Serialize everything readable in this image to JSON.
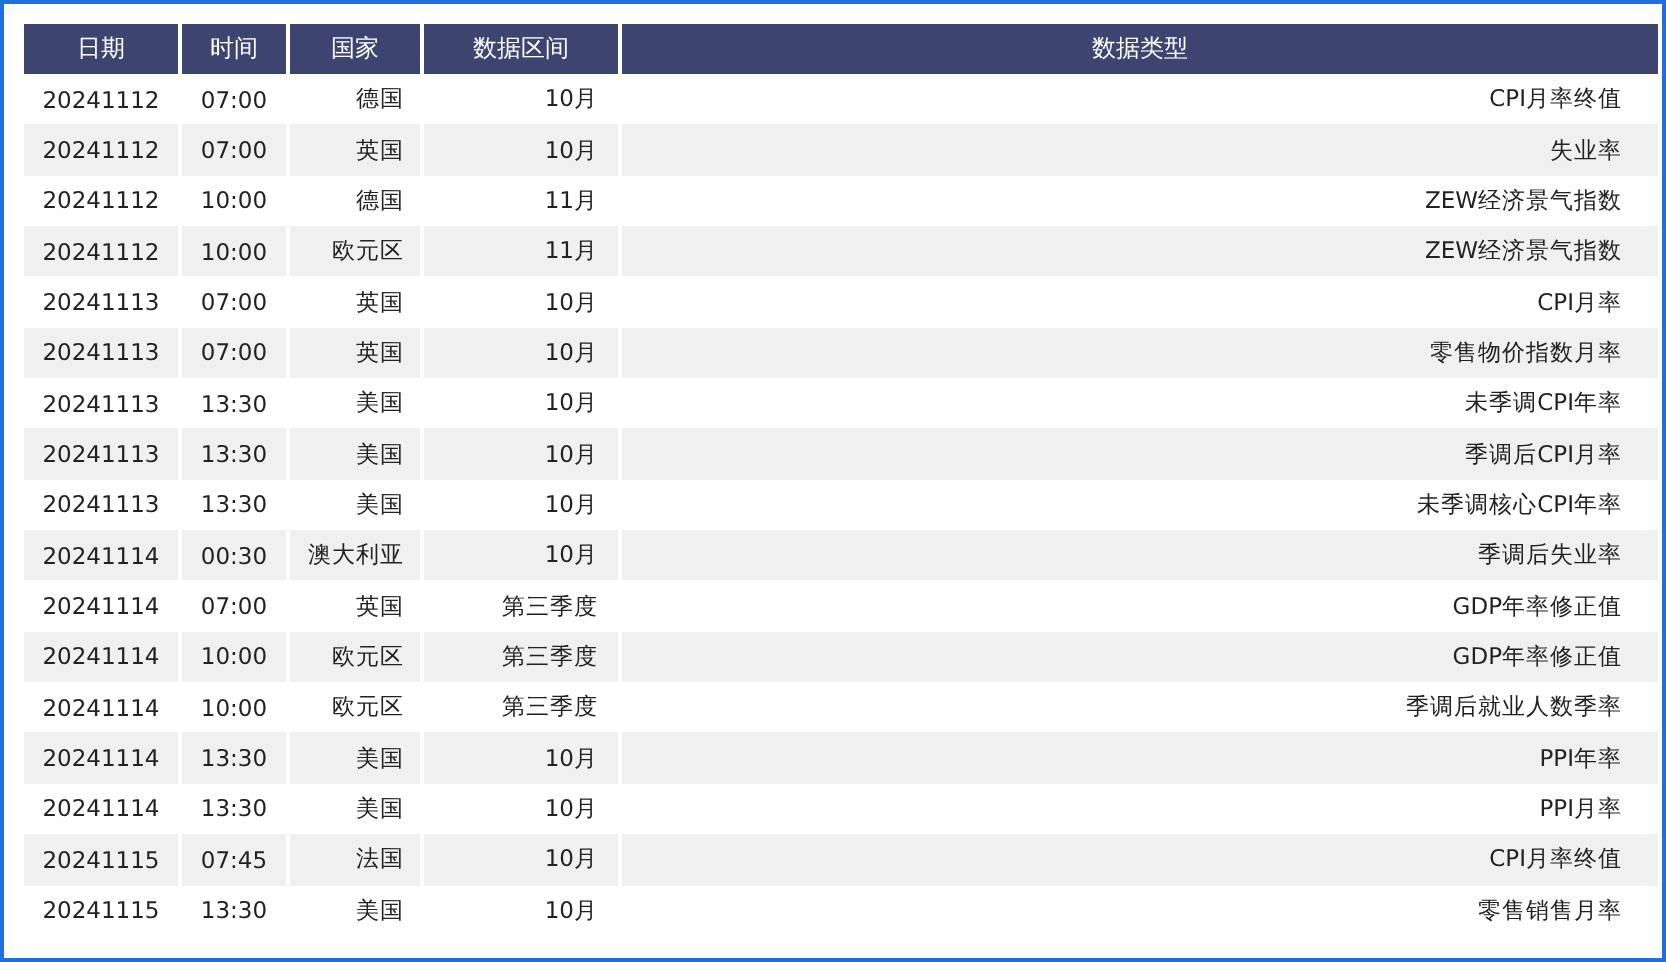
{
  "table": {
    "columns": [
      "日期",
      "时间",
      "国家",
      "数据区间",
      "数据类型"
    ],
    "rows": [
      [
        "20241112",
        "07:00",
        "德国",
        "10月",
        "CPI月率终值"
      ],
      [
        "20241112",
        "07:00",
        "英国",
        "10月",
        "失业率"
      ],
      [
        "20241112",
        "10:00",
        "德国",
        "11月",
        "ZEW经济景气指数"
      ],
      [
        "20241112",
        "10:00",
        "欧元区",
        "11月",
        "ZEW经济景气指数"
      ],
      [
        "20241113",
        "07:00",
        "英国",
        "10月",
        "CPI月率"
      ],
      [
        "20241113",
        "07:00",
        "英国",
        "10月",
        "零售物价指数月率"
      ],
      [
        "20241113",
        "13:30",
        "美国",
        "10月",
        "未季调CPI年率"
      ],
      [
        "20241113",
        "13:30",
        "美国",
        "10月",
        "季调后CPI月率"
      ],
      [
        "20241113",
        "13:30",
        "美国",
        "10月",
        "未季调核心CPI年率"
      ],
      [
        "20241114",
        "00:30",
        "澳大利亚",
        "10月",
        "季调后失业率"
      ],
      [
        "20241114",
        "07:00",
        "英国",
        "第三季度",
        "GDP年率修正值"
      ],
      [
        "20241114",
        "10:00",
        "欧元区",
        "第三季度",
        "GDP年率修正值"
      ],
      [
        "20241114",
        "10:00",
        "欧元区",
        "第三季度",
        "季调后就业人数季率"
      ],
      [
        "20241114",
        "13:30",
        "美国",
        "10月",
        "PPI年率"
      ],
      [
        "20241114",
        "13:30",
        "美国",
        "10月",
        "PPI月率"
      ],
      [
        "20241115",
        "07:45",
        "法国",
        "10月",
        "CPI月率终值"
      ],
      [
        "20241115",
        "13:30",
        "美国",
        "10月",
        "零售销售月率"
      ]
    ]
  }
}
